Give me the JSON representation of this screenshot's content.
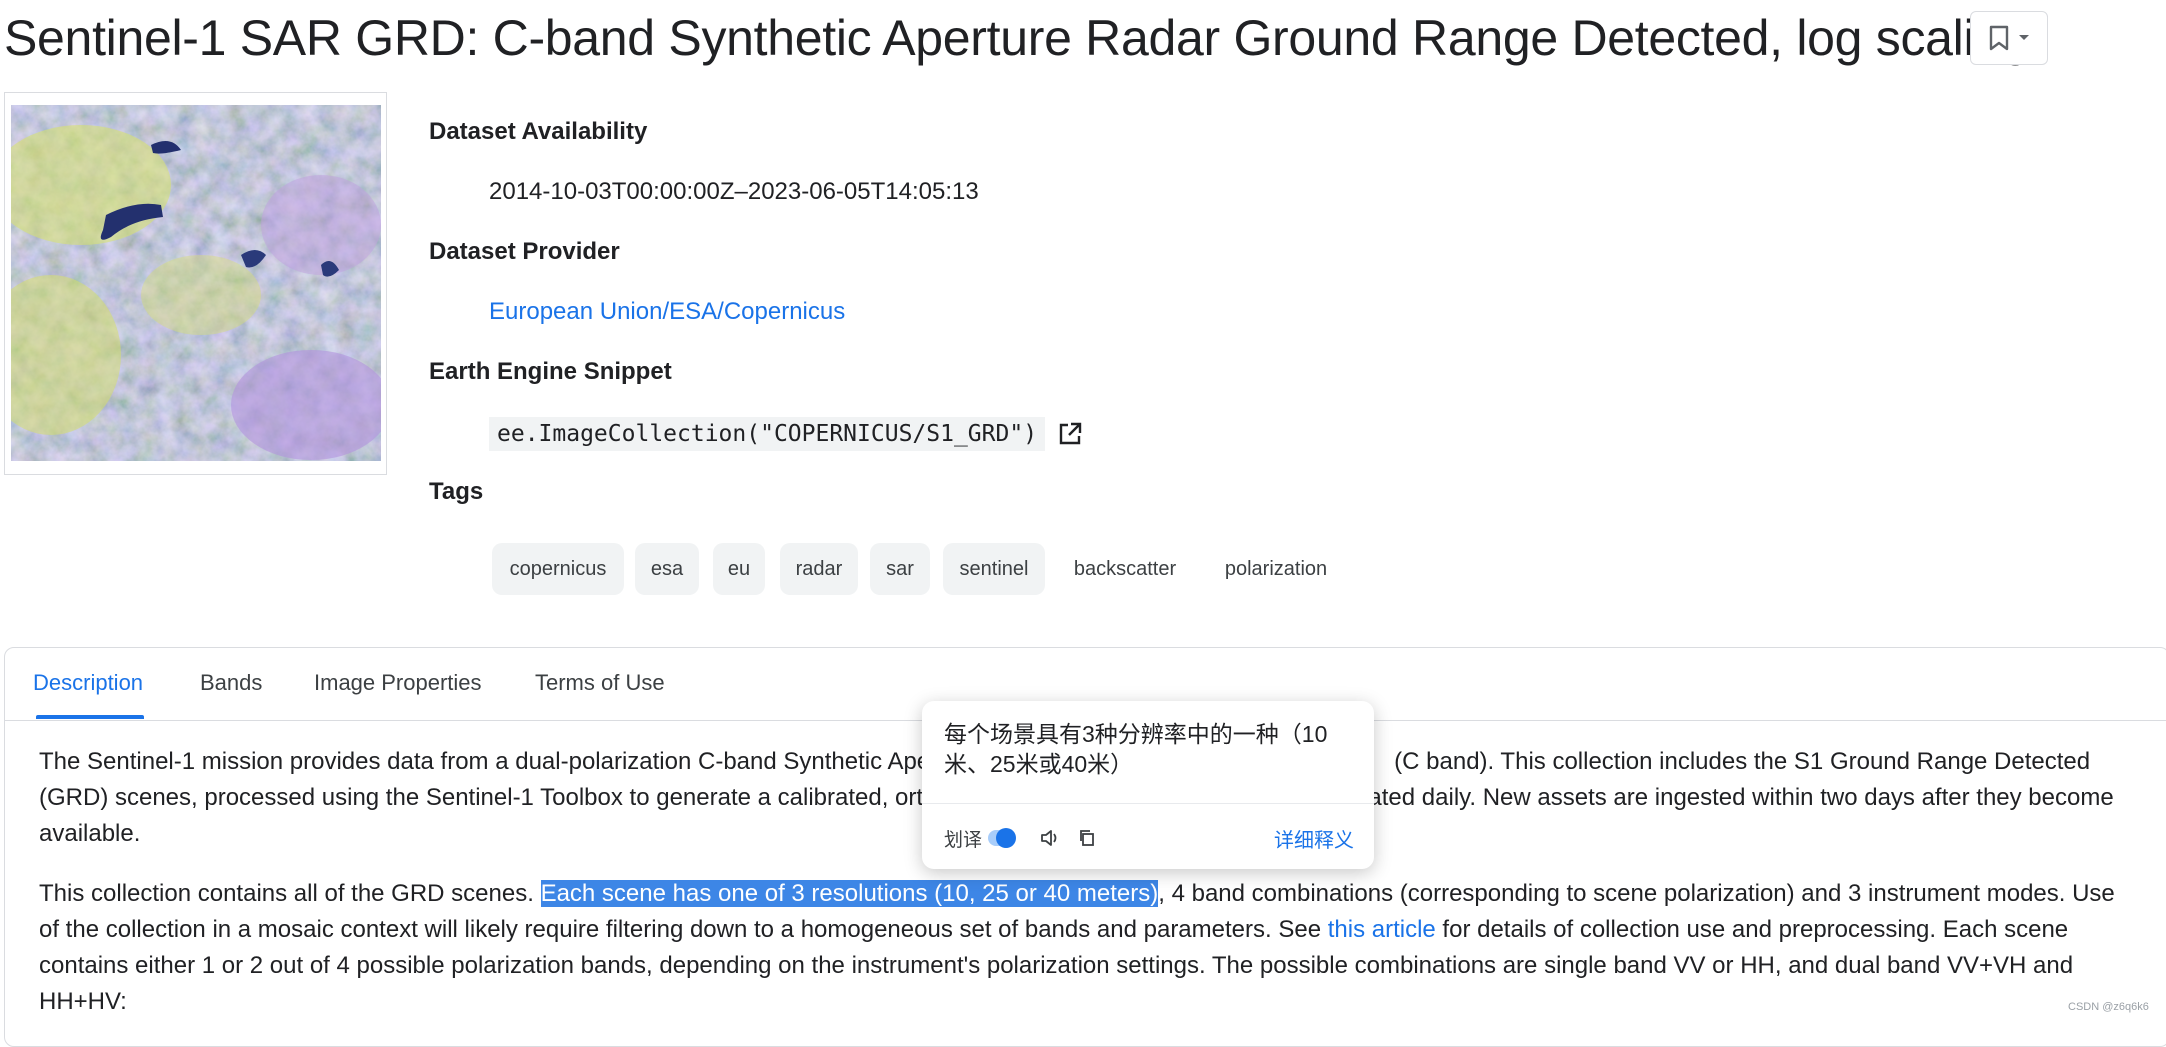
{
  "page": {
    "title": "Sentinel-1 SAR GRD: C-band Synthetic Aperture Radar Ground Range Detected, log scaling"
  },
  "metadata": {
    "availability_label": "Dataset Availability",
    "availability_value": "2014-10-03T00:00:00Z–2023-06-05T14:05:13",
    "provider_label": "Dataset Provider",
    "provider_value": "European Union/ESA/Copernicus",
    "snippet_label": "Earth Engine Snippet",
    "snippet_code": "ee.ImageCollection(\"COPERNICUS/S1_GRD\")",
    "tags_label": "Tags",
    "tags": [
      "copernicus",
      "esa",
      "eu",
      "radar",
      "sar",
      "sentinel",
      "backscatter",
      "polarization"
    ]
  },
  "tabs": [
    "Description",
    "Bands",
    "Image Properties",
    "Terms of Use"
  ],
  "description": {
    "p1_line1_a": "The Sentinel-1 mission provides data from a dual-polarization C-band Synthetic Ape",
    "p1_line1_b": "(C band). This collection includes the S1 Ground Range Detected",
    "p1_line2_a": "(GRD) scenes, processed using the Sentinel-1 Toolbox to generate a calibrated, orth",
    "p1_line2_b": "ated daily. New assets are ingested within two days after they become",
    "p1_line3": "available.",
    "p2_before": "This collection contains all of the GRD scenes. ",
    "p2_highlight": "Each scene has one of 3 resolutions (10, 25 or 40 meters)",
    "p2_after1": ", 4 band combinations (corresponding to scene polarization) and 3 instrument modes. Use",
    "p2_line2_a": "of the collection in a mosaic context will likely require filtering down to a homogeneous set of bands and parameters. See ",
    "p2_link": "this article",
    "p2_line2_b": " for details of collection use and preprocessing. Each scene",
    "p2_line3": "contains either 1 or 2 out of 4 possible polarization bands, depending on the instrument's polarization settings. The possible combinations are single band VV or HH, and dual band VV+VH and",
    "p2_line4": "HH+HV:"
  },
  "popup": {
    "translation": "每个场景具有3种分辨率中的一种（10米、25米或40米）",
    "toggle_label": "划译",
    "detail_link": "详细释义"
  },
  "watermark": "CSDN @z6q6k6",
  "colors": {
    "accent": "#1a73e8",
    "highlight": "#3d86e6",
    "chip_bg": "#f1f3f4"
  }
}
